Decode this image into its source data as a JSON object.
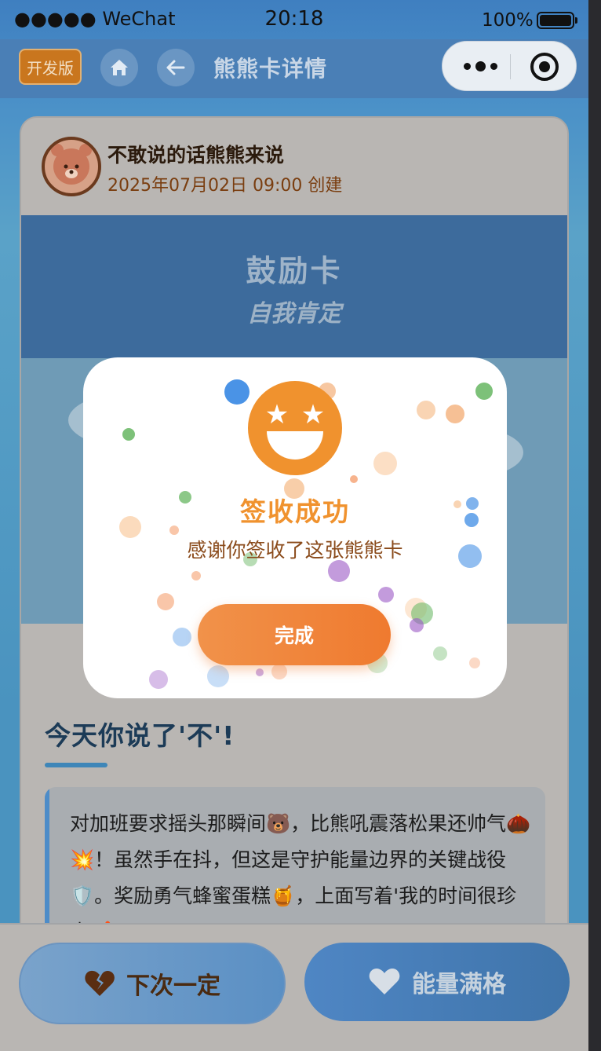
{
  "status_bar": {
    "carrier": "●●●●● WeChat",
    "time": "20:18",
    "battery": "100%",
    "battery_level": 1.0
  },
  "nav": {
    "dev_badge": "开发版",
    "title": "熊熊卡详情"
  },
  "card": {
    "creator_name": "不敢说的话熊熊来说",
    "created_at": "2025年07月02日 09:00 创建",
    "banner_title": "鼓励卡",
    "banner_subtitle": "自我肯定",
    "reason_title": "今天你说了'不'!",
    "reason_text": "对加班要求摇头那瞬间🐻，比熊吼震落松果还帅气🌰💥！虽然手在抖，但这是守护能量边界的关键战役🛡️。奖励勇气蜂蜜蛋糕🍯，上面写着'我的时间很珍贵'🍰"
  },
  "actions": {
    "fail_label": "下次一定",
    "full_label": "能量满格"
  },
  "modal": {
    "title": "签收成功",
    "message": "感谢你签收了这张熊熊卡",
    "done_label": "完成"
  },
  "colors": {
    "accent_orange": "#f0922e",
    "primary_blue": "#4a7fb6",
    "brown_text": "#7a3e10"
  }
}
